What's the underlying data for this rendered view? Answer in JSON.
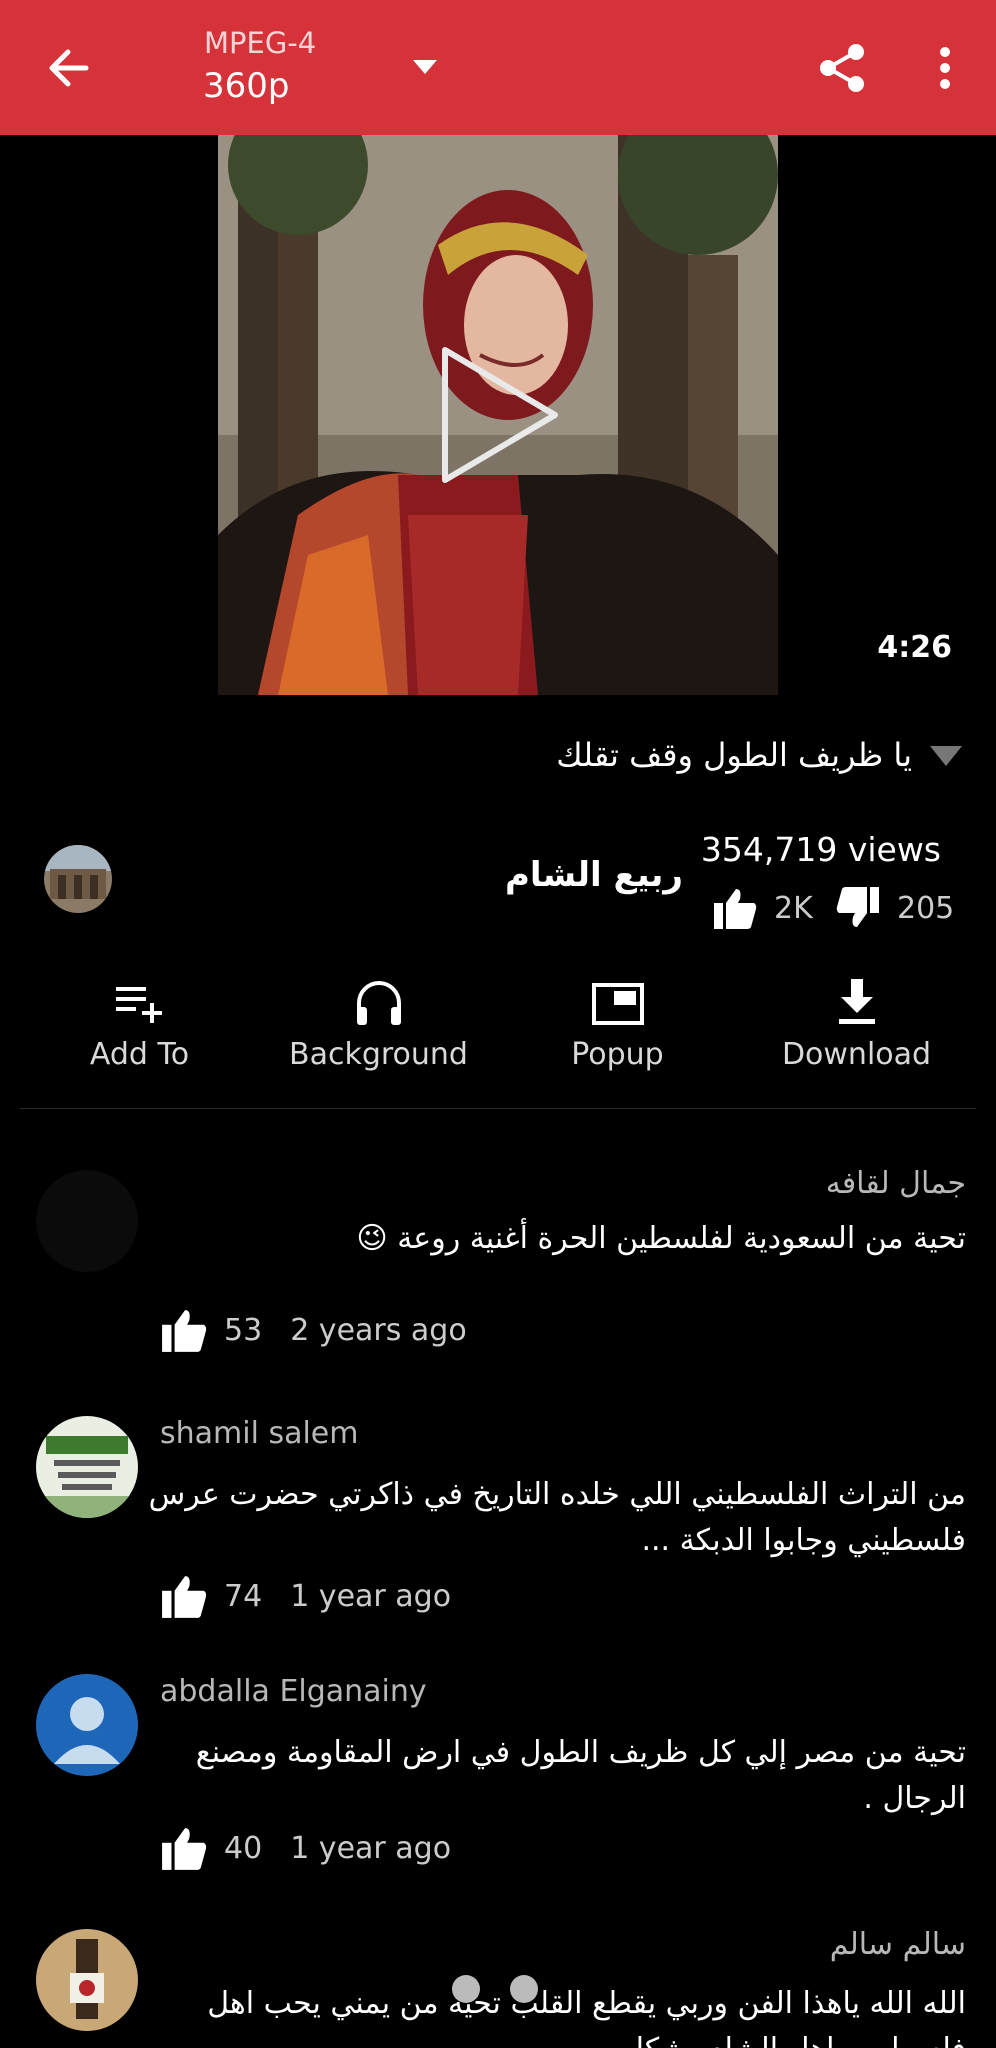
{
  "toolbar": {
    "format": "MPEG-4",
    "quality": "360p",
    "back_icon": "arrow-left-icon",
    "share_icon": "share-icon",
    "more_icon": "more-vertical-icon",
    "background_color": "#d6323a"
  },
  "video": {
    "duration": "4:26",
    "title": "يا ظريف الطول وقف تقلك"
  },
  "channel": {
    "name": "ربيع الشام",
    "views": "354,719 views",
    "likes": "2K",
    "dislikes": "205"
  },
  "actions": [
    {
      "label": "Add To",
      "icon": "playlist-add-icon"
    },
    {
      "label": "Background",
      "icon": "headphones-icon"
    },
    {
      "label": "Popup",
      "icon": "popup-icon"
    },
    {
      "label": "Download",
      "icon": "download-icon"
    }
  ],
  "comments": [
    {
      "author": "جمال لقافه",
      "text": "تحية من السعودية لفلسطين الحرة أغنية روعة 😉",
      "likes": "53",
      "time": "2 years ago"
    },
    {
      "author": "shamil salem",
      "text": "من التراث الفلسطيني اللي خلده التاريخ في ذاكرتي حضرت عرس فلسطيني وجابوا الدبكة ...",
      "likes": "74",
      "time": "1 year ago"
    },
    {
      "author": "abdalla Elganainy",
      "text": "تحية من مصر إلي كل ظريف الطول في ارض المقاومة ومصنع الرجال .",
      "likes": "40",
      "time": "1 year ago"
    },
    {
      "author": "سالم سالم",
      "text": "الله الله ياهذا الفن وربي يقطع القلب تحيه من يمني يحب اهل فلسطين واهل الشام بشكل"
    }
  ]
}
